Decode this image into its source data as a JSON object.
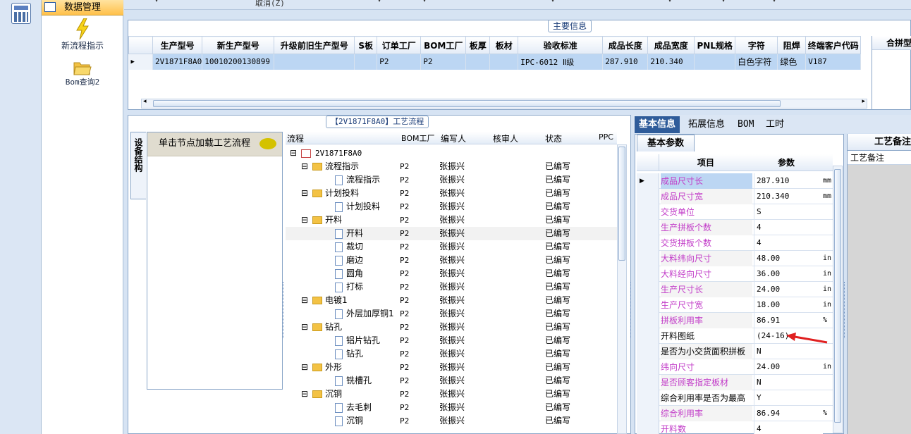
{
  "nav": {
    "header": "数据管理",
    "items": [
      {
        "label": "新流程指示",
        "icon": "lightning-icon"
      },
      {
        "label": "Bom查询2",
        "icon": "folder-open-icon"
      }
    ]
  },
  "toolbar": {
    "cancel_label": "取消(Z)"
  },
  "main_info": {
    "title": "主要信息",
    "columns": [
      "生产型号",
      "新生产型号",
      "升级前旧生产型号",
      "S板",
      "订单工厂",
      "BOM工厂",
      "板厚",
      "板材",
      "验收标准",
      "成品长度",
      "成品宽度",
      "PNL规格",
      "字符",
      "阻焊",
      "终端客户代码"
    ],
    "row": [
      "2V1871F8A0",
      "10010200130899",
      "",
      "",
      "P2",
      "P2",
      "",
      "",
      "IPC-6012 Ⅱ级",
      "287.910",
      "210.340",
      "",
      "白色字符",
      "绿色",
      "V187"
    ],
    "right_header": "合拼型"
  },
  "process": {
    "title": "【2V1871F8A0】工艺流程",
    "side_tab": "设备结构",
    "side_hint": "单击节点加载工艺流程",
    "columns": [
      "流程",
      "BOM工厂",
      "编写人",
      "核审人",
      "状态",
      "PPC"
    ],
    "root": "2V1871F8A0",
    "rows": [
      {
        "label": "流程指示",
        "type": "folder",
        "factory": "P2",
        "writer": "张振兴",
        "status": "已编写"
      },
      {
        "label": "流程指示",
        "type": "doc",
        "factory": "P2",
        "writer": "张振兴",
        "status": "已编写"
      },
      {
        "label": "计划投料",
        "type": "folder",
        "factory": "P2",
        "writer": "张振兴",
        "status": "已编写"
      },
      {
        "label": "计划投料",
        "type": "doc",
        "factory": "P2",
        "writer": "张振兴",
        "status": "已编写"
      },
      {
        "label": "开料",
        "type": "folder",
        "factory": "P2",
        "writer": "张振兴",
        "status": "已编写"
      },
      {
        "label": "开料",
        "type": "doc",
        "factory": "P2",
        "writer": "张振兴",
        "status": "已编写"
      },
      {
        "label": "裁切",
        "type": "doc",
        "factory": "P2",
        "writer": "张振兴",
        "status": "已编写"
      },
      {
        "label": "磨边",
        "type": "doc",
        "factory": "P2",
        "writer": "张振兴",
        "status": "已编写"
      },
      {
        "label": "圆角",
        "type": "doc",
        "factory": "P2",
        "writer": "张振兴",
        "status": "已编写"
      },
      {
        "label": "打标",
        "type": "doc",
        "factory": "P2",
        "writer": "张振兴",
        "status": "已编写"
      },
      {
        "label": "电镀1",
        "type": "folder",
        "factory": "P2",
        "writer": "张振兴",
        "status": "已编写"
      },
      {
        "label": "外层加厚铜1",
        "type": "doc",
        "factory": "P2",
        "writer": "张振兴",
        "status": "已编写"
      },
      {
        "label": "钻孔",
        "type": "folder",
        "factory": "P2",
        "writer": "张振兴",
        "status": "已编写"
      },
      {
        "label": "铝片钻孔",
        "type": "doc",
        "factory": "P2",
        "writer": "张振兴",
        "status": "已编写"
      },
      {
        "label": "钻孔",
        "type": "doc",
        "factory": "P2",
        "writer": "张振兴",
        "status": "已编写"
      },
      {
        "label": "外形",
        "type": "folder",
        "factory": "P2",
        "writer": "张振兴",
        "status": "已编写"
      },
      {
        "label": "铣槽孔",
        "type": "doc",
        "factory": "P2",
        "writer": "张振兴",
        "status": "已编写"
      },
      {
        "label": "沉铜",
        "type": "folder",
        "factory": "P2",
        "writer": "张振兴",
        "status": "已编写"
      },
      {
        "label": "去毛刺",
        "type": "doc",
        "factory": "P2",
        "writer": "张振兴",
        "status": "已编写"
      },
      {
        "label": "沉铜",
        "type": "doc",
        "factory": "P2",
        "writer": "张振兴",
        "status": "已编写"
      }
    ]
  },
  "right_tabs": [
    "基本信息",
    "拓展信息",
    "BOM",
    "工时"
  ],
  "params": {
    "subtab": "基本参数",
    "col_item": "项目",
    "col_param": "参数",
    "rows": [
      {
        "name": "成品尺寸长",
        "value": "287.910",
        "unit": "mm",
        "pink": true
      },
      {
        "name": "成品尺寸宽",
        "value": "210.340",
        "unit": "mm",
        "pink": true
      },
      {
        "name": "交货单位",
        "value": "S",
        "unit": "",
        "pink": true
      },
      {
        "name": "生产拼板个数",
        "value": "4",
        "unit": "",
        "pink": true
      },
      {
        "name": "交货拼板个数",
        "value": "4",
        "unit": "",
        "pink": true
      },
      {
        "name": "大料纬向尺寸",
        "value": "48.00",
        "unit": "in",
        "pink": true
      },
      {
        "name": "大料经向尺寸",
        "value": "36.00",
        "unit": "in",
        "pink": true
      },
      {
        "name": "生产尺寸长",
        "value": "24.00",
        "unit": "in",
        "pink": true
      },
      {
        "name": "生产尺寸宽",
        "value": "18.00",
        "unit": "in",
        "pink": true
      },
      {
        "name": "拼板利用率",
        "value": "86.91",
        "unit": "%",
        "pink": true
      },
      {
        "name": "开料图纸",
        "value": "(24-16)",
        "unit": "",
        "pink": false
      },
      {
        "name": "是否为小交货面积拼板",
        "value": "N",
        "unit": "",
        "pink": false
      },
      {
        "name": "纬向尺寸",
        "value": "24.00",
        "unit": "in",
        "pink": true
      },
      {
        "name": "是否顾客指定板材",
        "value": "N",
        "unit": "",
        "pink": true
      },
      {
        "name": "综合利用率是否为最高",
        "value": "Y",
        "unit": "",
        "pink": false
      },
      {
        "name": "综合利用率",
        "value": "86.94",
        "unit": "%",
        "pink": true
      },
      {
        "name": "开料数",
        "value": "4",
        "unit": "",
        "pink": true
      }
    ]
  },
  "remarks": {
    "header": "工艺备注",
    "label": "工艺备注"
  },
  "colors": {
    "accent": "#2f5c9a",
    "pink_text": "#c23cc8",
    "selection": "#bcd6f3",
    "arrow": "#e02020"
  }
}
